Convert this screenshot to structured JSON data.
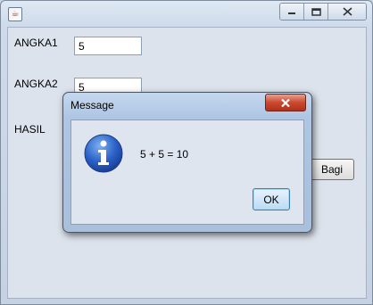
{
  "window": {
    "icon": "java-icon",
    "controls": {
      "minimize": "minimize-icon",
      "maximize": "maximize-icon",
      "close": "close-icon"
    }
  },
  "form": {
    "angka1_label": "ANGKA1",
    "angka1_value": "5",
    "angka2_label": "ANGKA2",
    "angka2_value": "5",
    "hasil_label": "HASIL",
    "bagi_button": "Bagi"
  },
  "dialog": {
    "title": "Message",
    "icon": "info-icon",
    "message": "5 + 5 = 10",
    "ok_label": "OK"
  }
}
